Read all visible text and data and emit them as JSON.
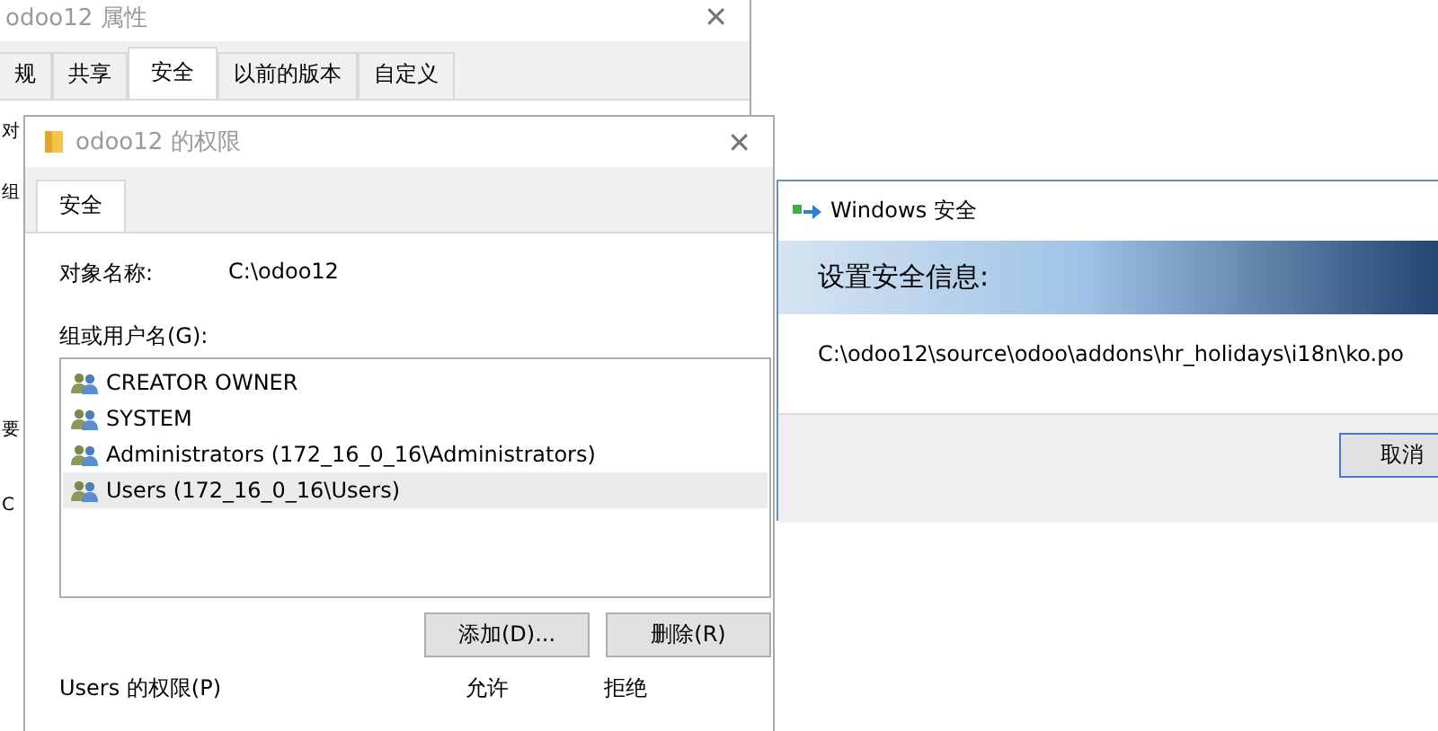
{
  "properties_window": {
    "title": "odoo12 属性",
    "close": "✕",
    "tabs": [
      {
        "label": "规",
        "selected": false
      },
      {
        "label": "共享",
        "selected": false
      },
      {
        "label": "安全",
        "selected": true
      },
      {
        "label": "以前的版本",
        "selected": false
      },
      {
        "label": "自定义",
        "selected": false
      }
    ],
    "peek_texts": [
      "对",
      "组",
      "要",
      "C"
    ]
  },
  "permissions_window": {
    "title": "odoo12 的权限",
    "close": "✕",
    "active": false,
    "tabs": [
      {
        "label": "安全",
        "selected": true
      }
    ],
    "object_label": "对象名称:",
    "object_value": "C:\\odoo12",
    "list_label": "组或用户名(G):",
    "users": [
      {
        "name": "CREATOR OWNER",
        "selected": false
      },
      {
        "name": "SYSTEM",
        "selected": false
      },
      {
        "name": "Administrators (172_16_0_16\\Administrators)",
        "selected": false
      },
      {
        "name": "Users (172_16_0_16\\Users)",
        "selected": true
      }
    ],
    "buttons": [
      "添加(D)...",
      "删除(R)"
    ],
    "permissions_label": "Users 的权限(P)",
    "columns": [
      "允许",
      "拒绝"
    ]
  },
  "security_dialog": {
    "title": "Windows 安全",
    "heading": "设置安全信息:",
    "path": "C:\\odoo12\\source\\odoo\\addons\\hr_holidays\\i18n\\ko.po",
    "buttons": [
      "取消"
    ]
  }
}
